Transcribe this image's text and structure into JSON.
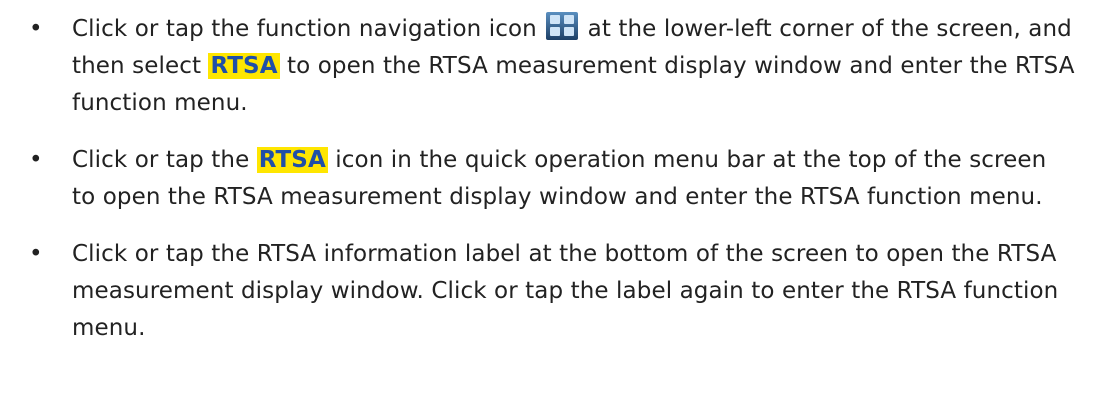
{
  "bullet_symbol": "•",
  "highlight_colors": {
    "background": "#ffe600",
    "text": "#1f4fa8"
  },
  "items": [
    {
      "before": "Click or tap the function navigation icon ",
      "icon": "function-navigation-icon",
      "after_icon": " at the lower-left corner of the screen, and then select ",
      "highlight": "RTSA",
      "after": " to open the RTSA measurement display window and enter the RTSA function menu."
    },
    {
      "before": "Click or tap the ",
      "highlight": "RTSA",
      "after": " icon in the quick operation menu bar at the top of the screen to open the RTSA measurement display window and enter the RTSA function menu."
    },
    {
      "text": "Click or tap the RTSA information label at the bottom of the screen to open the RTSA measurement display window. Click or tap the label again to enter the RTSA function menu."
    }
  ]
}
